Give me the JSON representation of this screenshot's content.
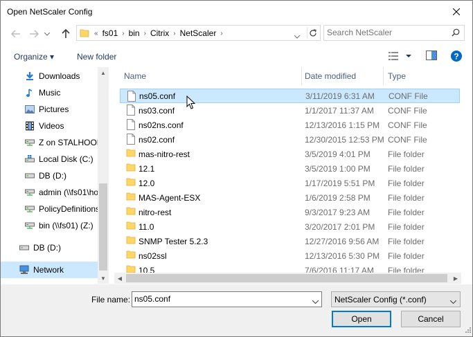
{
  "window": {
    "title": "Open NetScaler Config"
  },
  "address": {
    "prefix": "«",
    "crumbs": [
      "fs01",
      "bin",
      "Citrix",
      "NetScaler"
    ]
  },
  "search": {
    "placeholder": "Search NetScaler"
  },
  "toolbar": {
    "organize": "Organize ▾",
    "new_folder": "New folder"
  },
  "nav": {
    "items": [
      {
        "label": "Downloads",
        "icon": "download-icon"
      },
      {
        "label": "Music",
        "icon": "music-icon"
      },
      {
        "label": "Pictures",
        "icon": "pictures-icon"
      },
      {
        "label": "Videos",
        "icon": "videos-icon"
      },
      {
        "label": "Z on STALHOOD",
        "icon": "network-drive-icon"
      },
      {
        "label": "Local Disk (C:)",
        "icon": "local-disk-icon"
      },
      {
        "label": "DB (D:)",
        "icon": "drive-icon"
      },
      {
        "label": "admin (\\\\fs01\\ho",
        "icon": "network-drive-icon"
      },
      {
        "label": "PolicyDefinitions",
        "icon": "network-drive-icon"
      },
      {
        "label": "bin (\\\\fs01) (Z:)",
        "icon": "network-drive-icon"
      },
      {
        "label": "DB (D:)",
        "icon": "drive-icon"
      },
      {
        "label": "Network",
        "icon": "network-icon"
      }
    ]
  },
  "columns": {
    "name": "Name",
    "date": "Date modified",
    "type": "Type"
  },
  "files": [
    {
      "name": "ns05.conf",
      "date": "3/11/2019 6:31 AM",
      "type": "CONF File",
      "kind": "file"
    },
    {
      "name": "ns03.conf",
      "date": "1/1/2017 11:37 AM",
      "type": "CONF File",
      "kind": "file"
    },
    {
      "name": "ns02ns.conf",
      "date": "12/13/2016 1:15 PM",
      "type": "CONF File",
      "kind": "file"
    },
    {
      "name": "ns02.conf",
      "date": "12/30/2015 12:53 PM",
      "type": "CONF File",
      "kind": "file"
    },
    {
      "name": "mas-nitro-rest",
      "date": "3/5/2019 4:01 PM",
      "type": "File folder",
      "kind": "folder"
    },
    {
      "name": "12.1",
      "date": "3/5/2019 1:00 PM",
      "type": "File folder",
      "kind": "folder"
    },
    {
      "name": "12.0",
      "date": "1/17/2019 5:51 PM",
      "type": "File folder",
      "kind": "folder"
    },
    {
      "name": "MAS-Agent-ESX",
      "date": "1/6/2019 2:58 PM",
      "type": "File folder",
      "kind": "folder"
    },
    {
      "name": "nitro-rest",
      "date": "9/3/2017 9:23 AM",
      "type": "File folder",
      "kind": "folder"
    },
    {
      "name": "11.0",
      "date": "3/20/2017 2:01 PM",
      "type": "File folder",
      "kind": "folder"
    },
    {
      "name": "SNMP Tester 5.2.3",
      "date": "12/27/2016 9:56 AM",
      "type": "File folder",
      "kind": "folder"
    },
    {
      "name": "ns02ssl",
      "date": "12/13/2016 5:30 PM",
      "type": "File folder",
      "kind": "folder"
    },
    {
      "name": "10.5",
      "date": "7/6/2016 11:17 AM",
      "type": "File folder",
      "kind": "folder"
    }
  ],
  "footer": {
    "filename_label": "File name:",
    "filename_value": "ns05.conf",
    "filter_value": "NetScaler Config (*.conf)",
    "open_label": "Open",
    "cancel_label": "Cancel"
  },
  "colors": {
    "selection_bg": "#cce8ff",
    "selection_border": "#99d1ff",
    "accent": "#0078d7",
    "folder": "#ffd768"
  }
}
